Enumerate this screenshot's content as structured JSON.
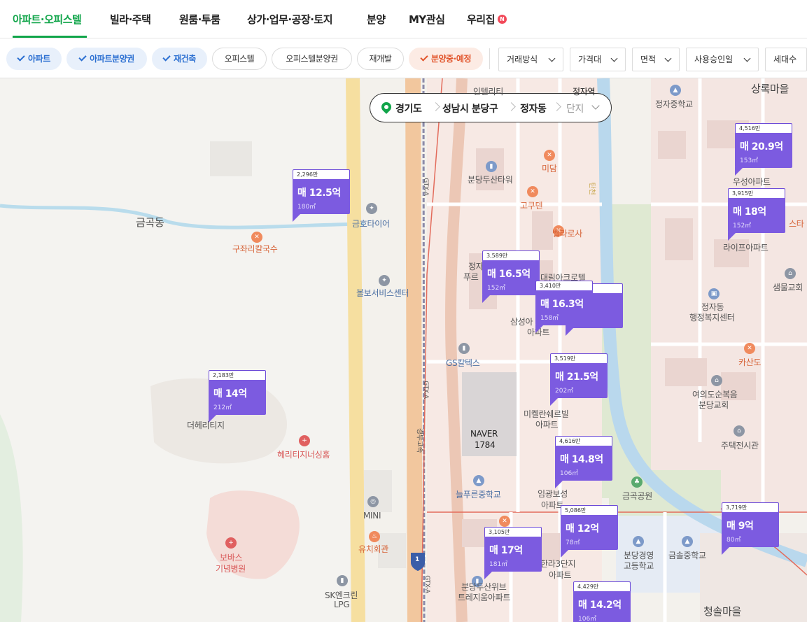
{
  "nav": {
    "tabs": [
      "아파트·오피스텔",
      "빌라·주택",
      "원룸·투룸",
      "상가·업무·공장·토지",
      "분양",
      "MY관심",
      "우리집"
    ],
    "badge": "N"
  },
  "filters": {
    "chips": [
      "아파트",
      "아파트분양권",
      "재건축",
      "오피스텔",
      "오피스텔분양권",
      "재개발",
      "분양중·예정"
    ],
    "dropdowns": [
      "거래방식",
      "가격대",
      "면적",
      "사용승인일",
      "세대수"
    ]
  },
  "breadcrumb": {
    "province": "경기도",
    "city": "성남시 분당구",
    "dong": "정자동",
    "complex": "단지"
  },
  "places": {
    "geumgok": "금곡동",
    "kumho": "금호타이어",
    "guzari": "구좌리칼국수",
    "bolbo": "볼보서비스센터",
    "deheritage": "더헤리티지",
    "heritage_home": "헤리티지너싱홈",
    "bobath1": "보바스",
    "bobath2": "기념병원",
    "mini": "MINI",
    "yuchi": "유치회관",
    "skenclean1": "SK엔크린",
    "skenclean2": "LPG",
    "inteliti": "인텔리티",
    "jeongja_station": "정자역",
    "sangrok": "상록마을",
    "jeongja_middle": "정자중학교",
    "bundang_doosan": "분당두산타워",
    "midam": "미담",
    "gokuten": "고쿠텐",
    "bella": "벨라로사",
    "woosung": "우성아파트",
    "starbucks": "스타",
    "life": "라이프아파트",
    "saemul": "샘물교회",
    "jeongja_office1": "정자동",
    "jeongja_office2": "행정복지센터",
    "daerim": "대림아크로텔",
    "samsung1": "삼성아",
    "samsung2": "아파트",
    "jeongja_pu1": "정자",
    "jeongja_pu2": "푸르",
    "gs": "GS칼텍스",
    "kasando": "카산도",
    "yeoui1": "여의도순복음",
    "yeoui2": "분당교회",
    "mikelan1": "미켈란쉐르빌",
    "mikelan2": "아파트",
    "naver1": "NAVER",
    "naver2": "1784",
    "housing": "주택전시관",
    "neulpureun": "늘푸른중학교",
    "imgwang1": "임광보성",
    "imgwang2": "아파트",
    "geumgok_park": "금곡공원",
    "hanra1": "한라3단지",
    "hanra2": "아파트",
    "bundang_gyeongyoung1": "분당경영",
    "bundang_gyeongyoung2": "고등학교",
    "geumsol_middle": "금솔중학교",
    "doosan_we1": "분당두산위브",
    "doosan_we2": "트레지움아파트",
    "cheongsol": "청솔마을",
    "gtx_a1": "GTX-A",
    "gtx_a2": "GTX-A",
    "gtx_a3": "GTX-A",
    "gyeongbu": "경부고속",
    "tancheon": "탄천",
    "sign1": "1"
  },
  "markers": [
    {
      "unit": "2,296만",
      "price": "매 12.5억",
      "area": "180㎡"
    },
    {
      "unit": "2,183만",
      "price": "매 14억",
      "area": "212㎡"
    },
    {
      "unit": "3,589만",
      "price": "매 16.5억",
      "area": "152㎡"
    },
    {
      "unit": "",
      "price": "억",
      "area": ""
    },
    {
      "unit": "3,410만",
      "price": "매 16.3억",
      "area": "158㎡"
    },
    {
      "unit": "3,519만",
      "price": "매 21.5억",
      "area": "202㎡"
    },
    {
      "unit": "4,516만",
      "price": "매 20.9억",
      "area": "153㎡"
    },
    {
      "unit": "3,915만",
      "price": "매 18억",
      "area": "152㎡"
    },
    {
      "unit": "4,616만",
      "price": "매 14.8억",
      "area": "106㎡"
    },
    {
      "unit": "5,086만",
      "price": "매 12억",
      "area": "78㎡"
    },
    {
      "unit": "3,105만",
      "price": "매 17억",
      "area": "181㎡"
    },
    {
      "unit": "3,719만",
      "price": "매 9억",
      "area": "80㎡"
    },
    {
      "unit": "4,429만",
      "price": "매 14.2억",
      "area": "106㎡"
    }
  ],
  "colors": {
    "accent": "#11a54a",
    "marker": "#7c5be0",
    "chip_on": "#2b6fd1",
    "chip_warn": "#e2572e"
  }
}
